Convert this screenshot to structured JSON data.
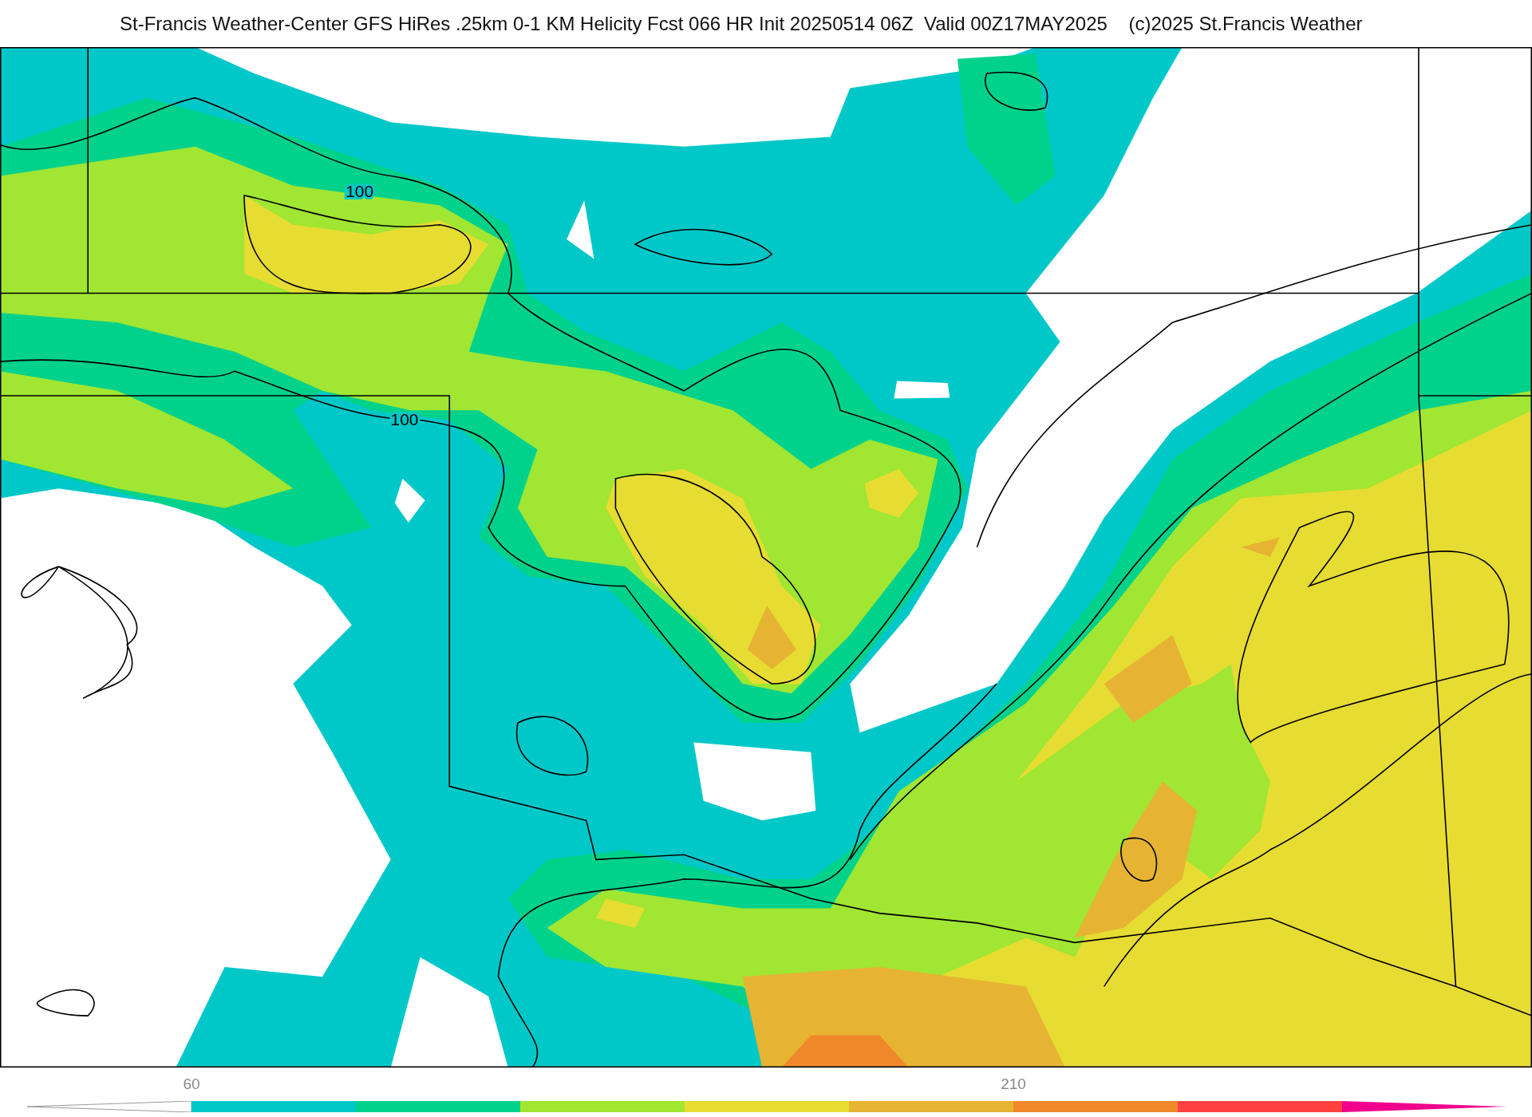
{
  "title": "St-Francis Weather-Center GFS HiRes .25km 0-1 KM Helicity Fcst 066 HR Init 20250514 06Z  Valid 00Z17MAY2025    (c)2025 St.Francis Weather",
  "map": {
    "contour_labels": [
      "100",
      "100"
    ]
  },
  "colorbar": {
    "segments": [
      {
        "kind": "low",
        "color": "#ffffff"
      },
      {
        "kind": "band",
        "color": "#00c8c8",
        "label": "60"
      },
      {
        "kind": "band",
        "color": "#00d28c"
      },
      {
        "kind": "band",
        "color": "#a0e632"
      },
      {
        "kind": "band",
        "color": "#e6dc32"
      },
      {
        "kind": "band",
        "color": "#e6b432"
      },
      {
        "kind": "band",
        "color": "#f0882a",
        "label": "210"
      },
      {
        "kind": "band",
        "color": "#ff4040"
      },
      {
        "kind": "high",
        "color": "#f0008c"
      }
    ]
  }
}
